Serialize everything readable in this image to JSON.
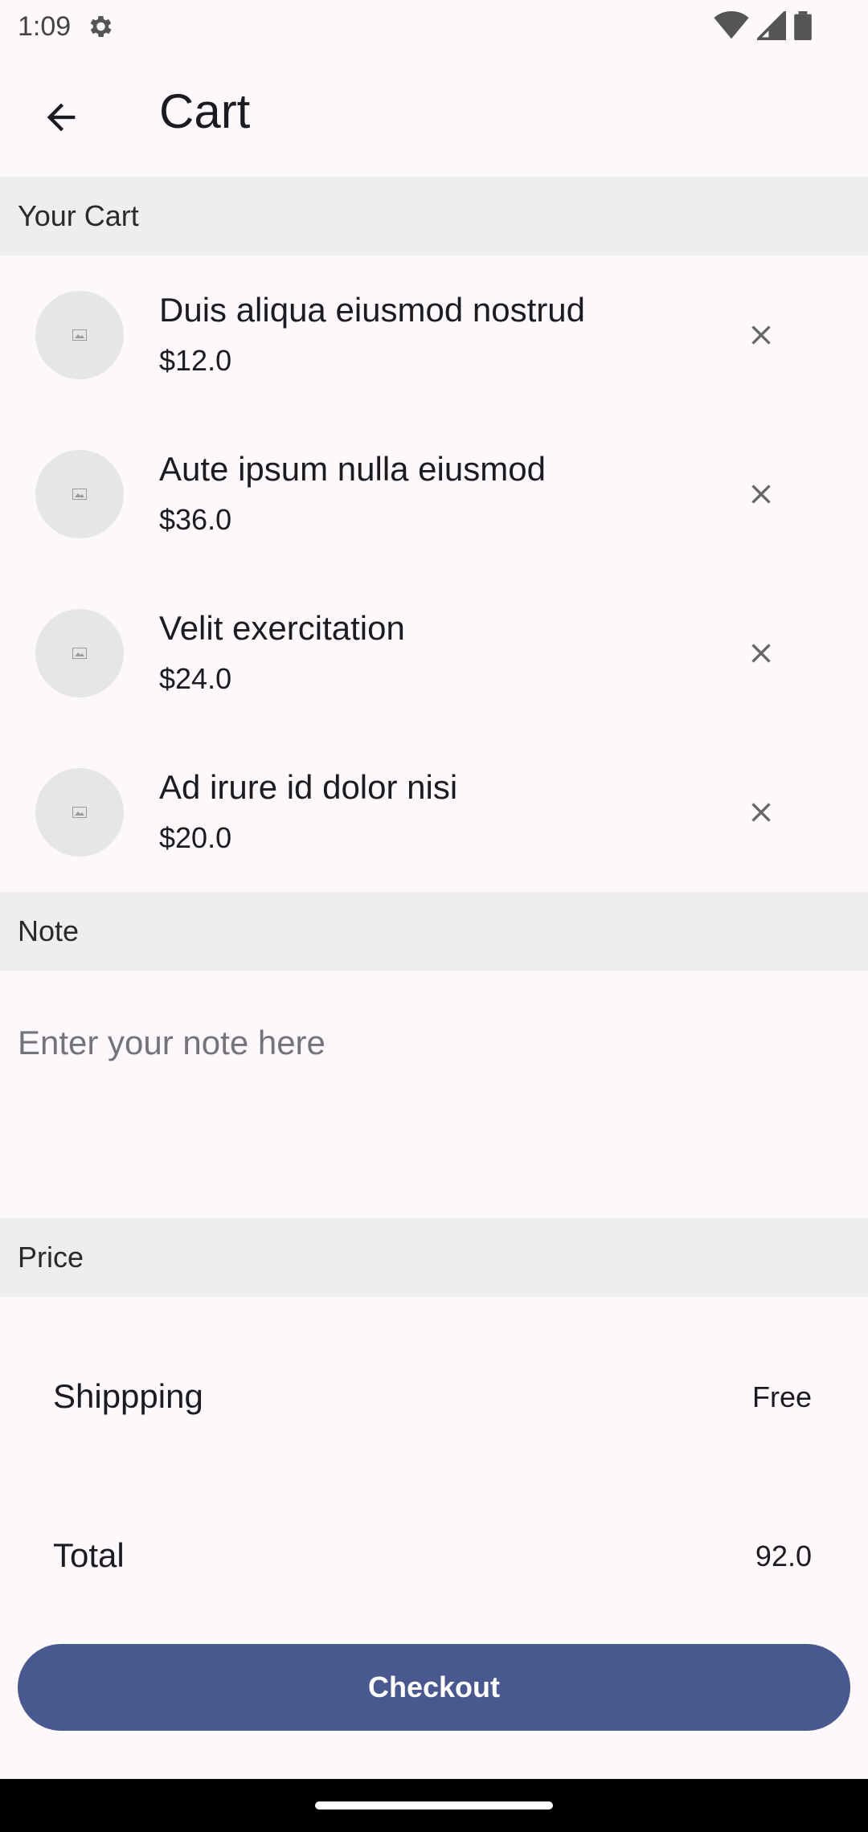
{
  "status_bar": {
    "time": "1:09",
    "icons": [
      "gear-icon",
      "wifi-icon",
      "signal-icon",
      "battery-icon"
    ]
  },
  "app_bar": {
    "title": "Cart",
    "back_icon": "arrow-back-icon"
  },
  "sections": {
    "cart_header": "Your Cart",
    "note_header": "Note",
    "price_header": "Price"
  },
  "cart_items": [
    {
      "name": "Duis aliqua eiusmod nostrud",
      "price": "$12.0"
    },
    {
      "name": "Aute ipsum nulla eiusmod",
      "price": "$36.0"
    },
    {
      "name": "Velit exercitation",
      "price": "$24.0"
    },
    {
      "name": "Ad irure id dolor nisi",
      "price": "$20.0"
    }
  ],
  "note": {
    "value": "",
    "placeholder": "Enter your note here"
  },
  "price": {
    "shipping_label": "Shippping",
    "shipping_value": "Free",
    "total_label": "Total",
    "total_value": "92.0"
  },
  "checkout": {
    "label": "Checkout"
  },
  "colors": {
    "accent": "#4A5890",
    "section_bg": "#EEEDEF",
    "page_bg": "#FDF8FC"
  }
}
